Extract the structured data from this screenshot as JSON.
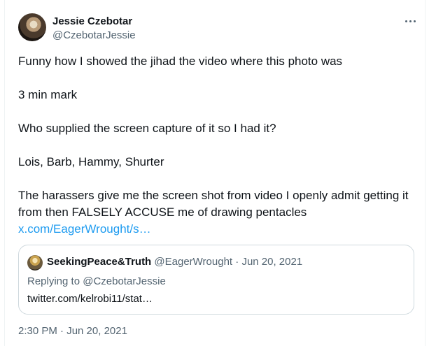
{
  "author": {
    "name": "Jessie Czebotar",
    "handle": "@CzebotarJessie"
  },
  "tweet": {
    "paragraphs": [
      "Funny how I showed the jihad the video where this photo was",
      "3 min mark",
      "Who supplied the screen capture of it so I had it?",
      "Lois, Barb, Hammy, Shurter"
    ],
    "last_paragraph": "The harassers give me the screen shot from video I openly admit getting it from then FALSELY ACCUSE me of drawing pentacles",
    "link": "x.com/EagerWrought/s…"
  },
  "quote": {
    "name": "SeekingPeace&Truth",
    "handle": "@EagerWrought",
    "separator": "·",
    "date": "Jun 20, 2021",
    "replying_prefix": "Replying to",
    "replying_to": "@CzebotarJessie",
    "text": "twitter.com/kelrobi11/stat…"
  },
  "timestamp": "2:30 PM · Jun 20, 2021",
  "icons": {
    "more": "more-horizontal-icon"
  },
  "colors": {
    "link": "#1d9bf0",
    "secondary_text": "#536471",
    "primary_text": "#0f1419",
    "border": "#cfd9de"
  }
}
